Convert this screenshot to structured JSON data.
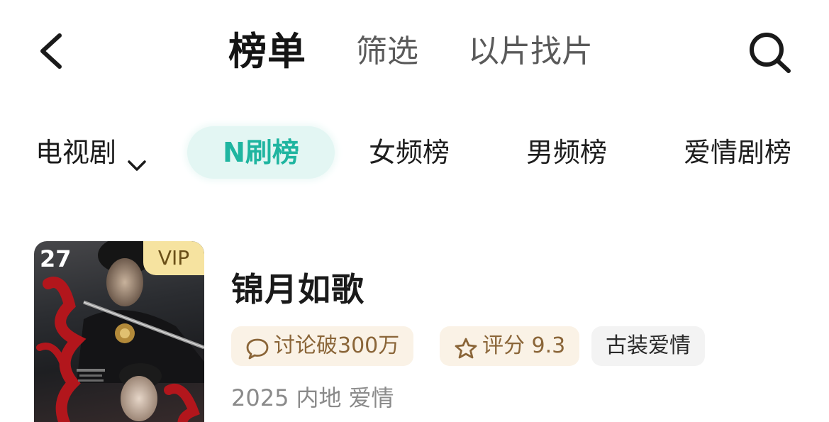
{
  "nav": {
    "tabs": [
      {
        "label": "榜单"
      },
      {
        "label": "筛选"
      },
      {
        "label": "以片找片"
      }
    ]
  },
  "categories": {
    "dropdown_label": "电视剧",
    "chips": [
      {
        "label": "N刷榜"
      },
      {
        "label": "女频榜"
      },
      {
        "label": "男频榜"
      },
      {
        "label": "爱情剧榜"
      }
    ]
  },
  "item": {
    "rank": "27",
    "vip": "VIP",
    "title": "锦月如歌",
    "tags": {
      "discussion": "讨论破300万",
      "score": "评分 9.3",
      "genre": "古装爱情"
    },
    "meta": {
      "year": "2025",
      "region": "内地",
      "genre": "爱情"
    }
  },
  "icons": {
    "back": "chevron-left-icon",
    "search": "search-icon",
    "dropdown": "chevron-down-icon",
    "discussion": "chat-bubble-icon",
    "score": "star-icon"
  },
  "colors": {
    "active_chip_text": "#1fb5a0",
    "active_chip_bg": "#e3f6f3",
    "vip_bg": "#f6e3a0",
    "tag_bg": "#faf2e6",
    "tag_text": "#8a6538"
  }
}
